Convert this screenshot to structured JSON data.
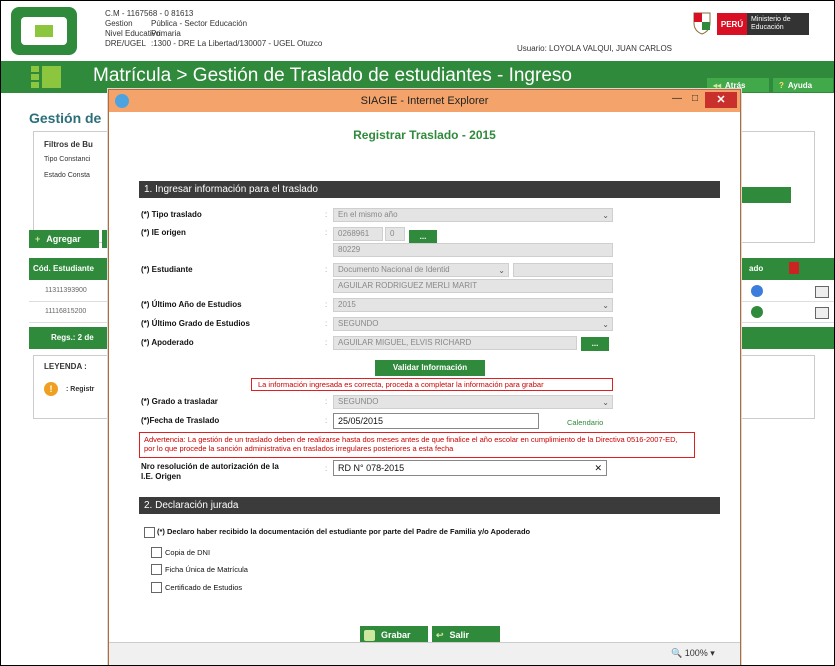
{
  "header": {
    "cm": "C.M - 1167568 - 0",
    "cm_code": "81613",
    "rows": [
      {
        "k": "Gestion",
        "v": "Pública - Sector Educación"
      },
      {
        "k": "Nivel Educativo",
        "v": "Primaria"
      },
      {
        "k": "DRE/UGEL",
        "v": ":1300 - DRE La Libertad/130007 - UGEL Otuzco"
      }
    ],
    "usuario": "Usuario: LOYOLA VALQUI, JUAN CARLOS",
    "peru": "PERÚ",
    "ministerio": "Ministerio de Educación"
  },
  "titlebar": {
    "title": "Matrícula > Gestión de Traslado de estudiantes - Ingreso",
    "atras": "Atrás",
    "ayuda": "Ayuda"
  },
  "background": {
    "gestion": "Gestión de",
    "filtros": "Filtros de Bu",
    "tipo": "Tipo Constanci",
    "estado": "Estado Consta",
    "agregar": "Agregar",
    "col_cod": "Cód. Estudiante",
    "col_estado": "ado",
    "rows": [
      "11311393900",
      "11116815200"
    ],
    "regs": "Regs.: 2 de",
    "leyenda": "LEYENDA :",
    "leyenda_item": ": Registr"
  },
  "modal": {
    "window_title": "SIAGIE - Internet Explorer",
    "form_title": "Registrar Traslado - 2015",
    "section1": "1. Ingresar información para el traslado",
    "tipo_traslado": {
      "label": "(*) Tipo traslado",
      "value": "En el mismo año"
    },
    "ie_origen": {
      "label": "(*) IE origen",
      "code": "0268961",
      "anexo": "0",
      "nombre": "80229"
    },
    "estudiante": {
      "label": "(*) Estudiante",
      "doc": "Documento Nacional de Identid",
      "nombre": "AGUILAR RODRIGUEZ MERLI MARIT"
    },
    "ultimo_anio": {
      "label": "(*) Último Año de Estudios",
      "value": "2015"
    },
    "ultimo_grado": {
      "label": "(*) Último Grado de Estudios",
      "value": "SEGUNDO"
    },
    "apoderado": {
      "label": "(*) Apoderado",
      "value": "AGUILAR MIGUEL, ELVIS RICHARD"
    },
    "validar": "Validar Información",
    "msg_ok": "La información ingresada es correcta, proceda a completar la información para grabar",
    "grado_trasladar": {
      "label": "(*) Grado a trasladar",
      "value": "SEGUNDO"
    },
    "fecha": {
      "label": "(*)Fecha de Traslado",
      "value": "25/05/2015",
      "calendario": "Calendario"
    },
    "advertencia": "Advertencia: La gestión de un traslado deben de realizarse hasta dos meses antes de que finalice el año escolar en cumplimiento de la Directiva 0516-2007-ED, por lo que procede la sanción administrativa en traslados irregulares posteriores a esta fecha",
    "resolucion": {
      "label_1": "Nro resolución de autorización de la",
      "label_2": "I.E. Origen",
      "value": "RD N° 078-2015"
    },
    "section2": "2. Declaración jurada",
    "declaro": "(*) Declaro haber recibido la documentación del estudiante por parte del Padre de Familia y/o Apoderado",
    "docs": [
      "Copia de DNI",
      "Ficha Única de Matrícula",
      "Certificado de Estudios"
    ],
    "grabar": "Grabar",
    "salir": "Salir",
    "zoom": "100%"
  }
}
